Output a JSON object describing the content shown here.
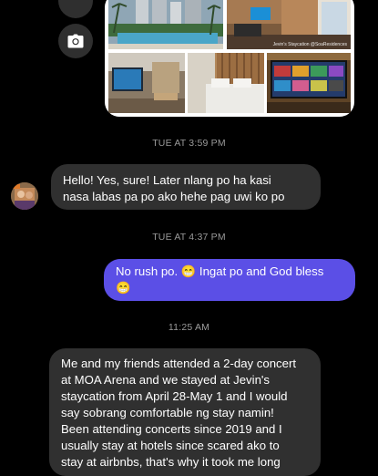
{
  "photo": {
    "watermark": "Jevin's Staycation @SoaResidences"
  },
  "timestamps": {
    "t1": "TUE AT 3:59 PM",
    "t2": "TUE AT 4:37 PM",
    "t3": "11:25 AM"
  },
  "messages": {
    "m1_line1": "Hello! Yes, sure! Later nlang po ha kasi",
    "m1_line2": "nasa labas pa po ako hehe pag uwi ko po",
    "m2_line1": "No rush po. 😁 Ingat po and God bless",
    "m2_line2": "😁",
    "m3_line1": "Me and my friends attended a 2-day concert",
    "m3_line2": "at MOA Arena and we stayed at Jevin's",
    "m3_line3": "staycation from April 28-May 1 and I would",
    "m3_line4": "say sobrang comfortable ng stay namin!",
    "m3_line5": "Been attending concerts since 2019 and I",
    "m3_line6": "usually stay at hotels since scared ako to",
    "m3_line7": "stay at airbnbs, that's why it took me long"
  },
  "icons": {
    "top_button": "share-icon",
    "camera": "camera-icon"
  },
  "colors": {
    "background": "#000000",
    "incoming_bubble": "#303030",
    "outgoing_bubble": "#5b4fe6",
    "timestamp": "#9a9a9a"
  }
}
